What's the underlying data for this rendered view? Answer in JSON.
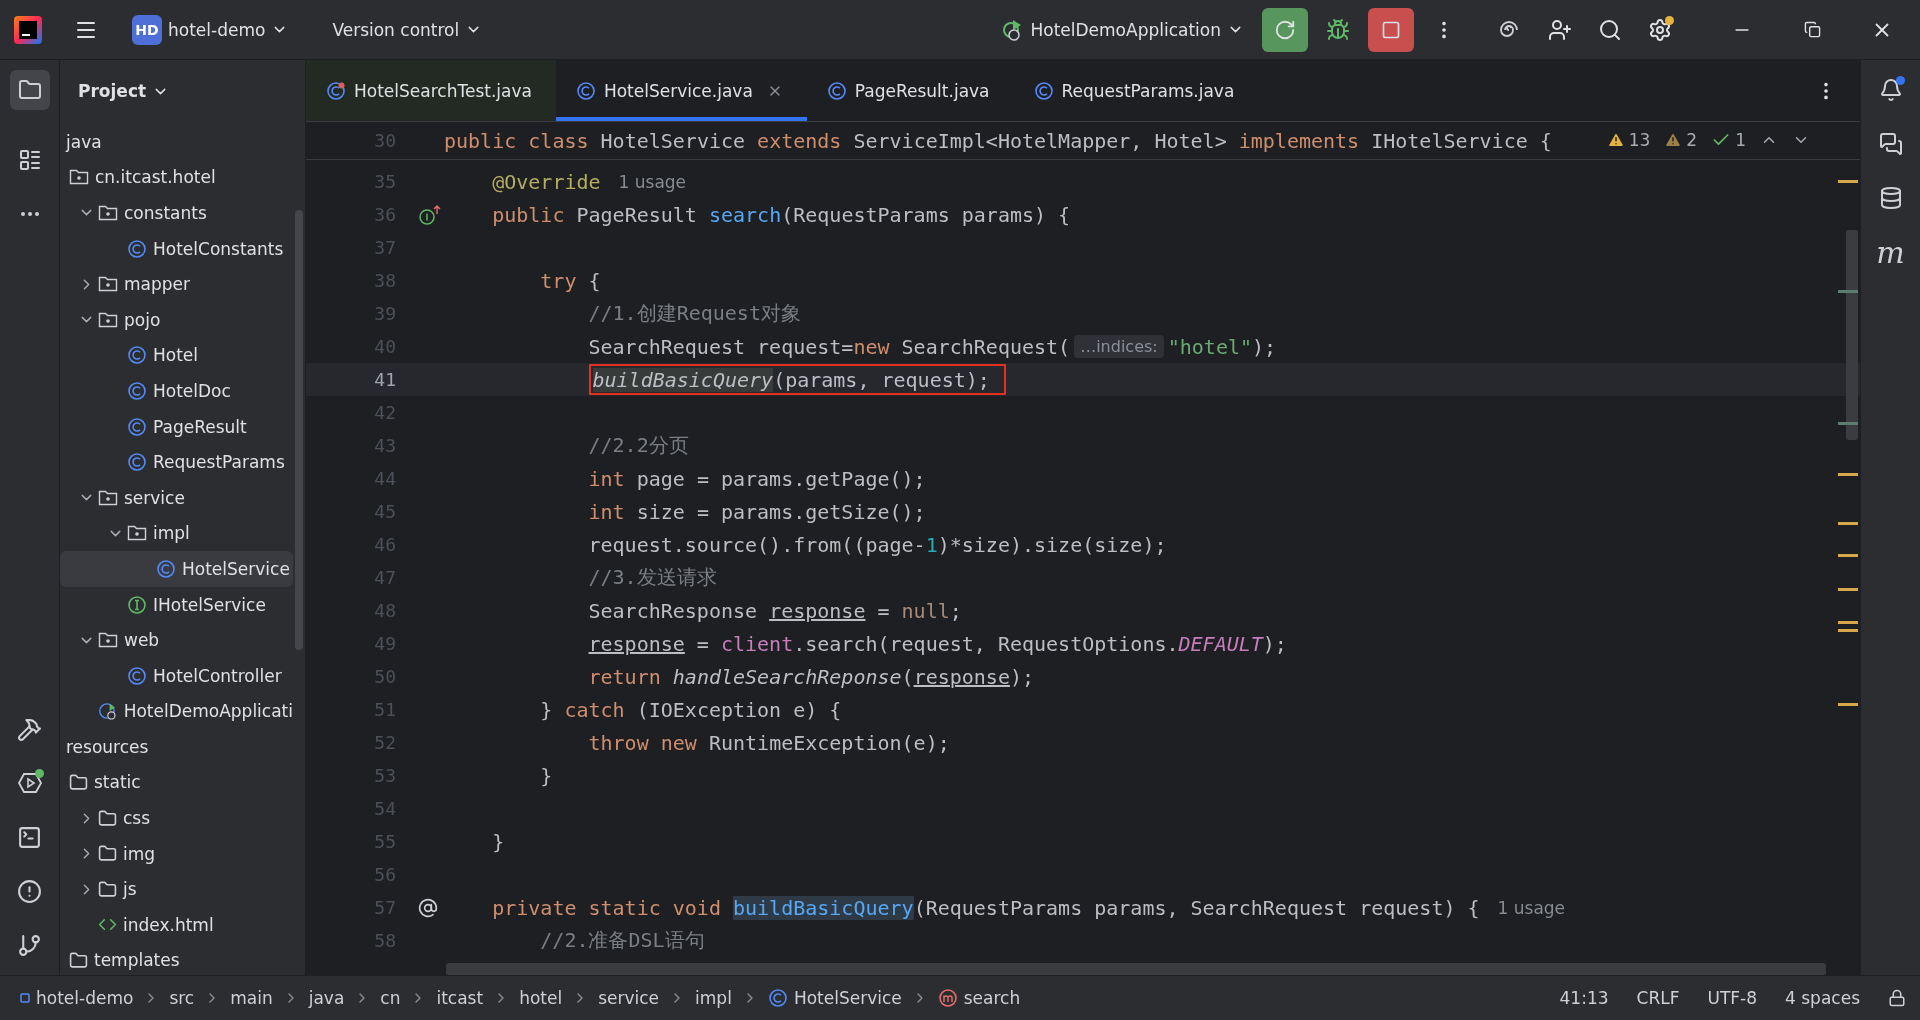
{
  "title_bar": {
    "project_badge": "HD",
    "project": "hotel-demo",
    "vcs": "Version control",
    "run_config": "HotelDemoApplication"
  },
  "project_panel": {
    "title": "Project",
    "tree": [
      {
        "label": "java",
        "kind": "root",
        "selected": false,
        "children": [
          {
            "label": "cn.itcast.hotel",
            "kind": "package",
            "selected": false,
            "children": [
              {
                "label": "constants",
                "kind": "package",
                "selected": false,
                "expanded": true,
                "children": [
                  {
                    "label": "HotelConstants",
                    "kind": "class",
                    "selected": false
                  }
                ]
              },
              {
                "label": "mapper",
                "kind": "package",
                "selected": false,
                "expanded": false
              },
              {
                "label": "pojo",
                "kind": "package",
                "selected": false,
                "expanded": true,
                "children": [
                  {
                    "label": "Hotel",
                    "kind": "class",
                    "selected": false
                  },
                  {
                    "label": "HotelDoc",
                    "kind": "class",
                    "selected": false
                  },
                  {
                    "label": "PageResult",
                    "kind": "class",
                    "selected": false
                  },
                  {
                    "label": "RequestParams",
                    "kind": "class",
                    "selected": false
                  }
                ]
              },
              {
                "label": "service",
                "kind": "package",
                "selected": false,
                "expanded": true,
                "children": [
                  {
                    "label": "impl",
                    "kind": "package",
                    "selected": false,
                    "expanded": true,
                    "children": [
                      {
                        "label": "HotelService",
                        "kind": "class",
                        "selected": true
                      }
                    ]
                  },
                  {
                    "label": "IHotelService",
                    "kind": "interface",
                    "selected": false
                  }
                ]
              },
              {
                "label": "web",
                "kind": "package",
                "selected": false,
                "expanded": true,
                "children": [
                  {
                    "label": "HotelController",
                    "kind": "class",
                    "selected": false
                  }
                ]
              },
              {
                "label": "HotelDemoApplicati",
                "kind": "app",
                "selected": false
              }
            ]
          }
        ]
      },
      {
        "label": "resources",
        "kind": "root",
        "selected": false,
        "children": [
          {
            "label": "static",
            "kind": "folder",
            "selected": false,
            "children": [
              {
                "label": "css",
                "kind": "folder",
                "selected": false,
                "expanded": false
              },
              {
                "label": "img",
                "kind": "folder",
                "selected": false,
                "expanded": false
              },
              {
                "label": "js",
                "kind": "folder",
                "selected": false,
                "expanded": false
              },
              {
                "label": "index.html",
                "kind": "html",
                "selected": false
              }
            ]
          },
          {
            "label": "templates",
            "kind": "folder",
            "selected": false
          }
        ]
      }
    ]
  },
  "tabs": [
    {
      "label": "HotelSearchTest.java",
      "kind": "test",
      "selected": false
    },
    {
      "label": "HotelService.java",
      "kind": "class",
      "selected": true
    },
    {
      "label": "PageResult.java",
      "kind": "class",
      "selected": false
    },
    {
      "label": "RequestParams.java",
      "kind": "class",
      "selected": false
    }
  ],
  "editor": {
    "problems": {
      "warnings": "13",
      "weak_warnings": "2",
      "typos": "1"
    },
    "sticky": {
      "n": "30",
      "tokens": [
        {
          "text": "public ",
          "kind": "kw"
        },
        {
          "text": "class ",
          "kind": "kw"
        },
        {
          "text": "HotelService ",
          "kind": "plain"
        },
        {
          "text": "extends ",
          "kind": "kw"
        },
        {
          "text": "ServiceImpl<HotelMapper, Hotel> ",
          "kind": "plain"
        },
        {
          "text": "implements ",
          "kind": "kw"
        },
        {
          "text": "IHotelService {",
          "kind": "plain"
        }
      ]
    },
    "lines": [
      {
        "n": "35",
        "current": false,
        "boxed": false,
        "tokens": [
          {
            "text": "    @Override",
            "kind": "annotation"
          },
          {
            "text": "1 usage",
            "kind": "hint"
          }
        ]
      },
      {
        "n": "36",
        "current": false,
        "boxed": false,
        "gutter": {
          "kind": "implements"
        },
        "tokens": [
          {
            "text": "    public ",
            "kind": "kw"
          },
          {
            "text": "PageResult ",
            "kind": "plain"
          },
          {
            "text": "search",
            "kind": "decl"
          },
          {
            "text": "(RequestParams params) {",
            "kind": "plain"
          }
        ]
      },
      {
        "n": "37",
        "current": false,
        "boxed": false
      },
      {
        "n": "38",
        "current": false,
        "boxed": false,
        "tokens": [
          {
            "text": "        try ",
            "kind": "kw"
          },
          {
            "text": "{",
            "kind": "plain"
          }
        ]
      },
      {
        "n": "39",
        "current": false,
        "boxed": false,
        "tokens": [
          {
            "text": "            //1.创建Request对象",
            "kind": "comment"
          }
        ]
      },
      {
        "n": "40",
        "current": false,
        "boxed": false,
        "tokens": [
          {
            "text": "            SearchRequest request=",
            "kind": "plain"
          },
          {
            "text": "new ",
            "kind": "kw"
          },
          {
            "text": "SearchRequest(",
            "kind": "plain"
          },
          {
            "text": "…indices:",
            "kind": "inlay"
          },
          {
            "text": "\"hotel\"",
            "kind": "string"
          },
          {
            "text": ");",
            "kind": "plain"
          }
        ]
      },
      {
        "n": "41",
        "current": true,
        "boxed": true,
        "tokens": [
          {
            "text": "            buildBasicQuery",
            "kind": "call_hl"
          },
          {
            "text": "(params, request);",
            "kind": "plain"
          }
        ]
      },
      {
        "n": "42",
        "current": false,
        "boxed": false
      },
      {
        "n": "43",
        "current": false,
        "boxed": false,
        "tokens": [
          {
            "text": "            //2.2分页",
            "kind": "comment"
          }
        ]
      },
      {
        "n": "44",
        "current": false,
        "boxed": false,
        "tokens": [
          {
            "text": "            int ",
            "kind": "kw"
          },
          {
            "text": "page = params.getPage();",
            "kind": "plain"
          }
        ]
      },
      {
        "n": "45",
        "current": false,
        "boxed": false,
        "tokens": [
          {
            "text": "            int ",
            "kind": "kw"
          },
          {
            "text": "size = params.getSize();",
            "kind": "plain"
          }
        ]
      },
      {
        "n": "46",
        "current": false,
        "boxed": false,
        "tokens": [
          {
            "text": "            request.source().from((page-",
            "kind": "plain"
          },
          {
            "text": "1",
            "kind": "number"
          },
          {
            "text": ")*size).size(size);",
            "kind": "plain"
          }
        ]
      },
      {
        "n": "47",
        "current": false,
        "boxed": false,
        "tokens": [
          {
            "text": "            //3.发送请求",
            "kind": "comment"
          }
        ]
      },
      {
        "n": "48",
        "current": false,
        "boxed": false,
        "tokens": [
          {
            "text": "            SearchResponse ",
            "kind": "plain"
          },
          {
            "text": "response",
            "kind": "var"
          },
          {
            "text": " = ",
            "kind": "plain"
          },
          {
            "text": "null",
            "kind": "null"
          },
          {
            "text": ";",
            "kind": "plain"
          }
        ]
      },
      {
        "n": "49",
        "current": false,
        "boxed": false,
        "tokens": [
          {
            "text": "            response",
            "kind": "var"
          },
          {
            "text": " = ",
            "kind": "plain"
          },
          {
            "text": "client",
            "kind": "field"
          },
          {
            "text": ".search(request, RequestOptions.",
            "kind": "plain"
          },
          {
            "text": "DEFAULT",
            "kind": "static_field"
          },
          {
            "text": ");",
            "kind": "plain"
          }
        ]
      },
      {
        "n": "50",
        "current": false,
        "boxed": false,
        "tokens": [
          {
            "text": "            return ",
            "kind": "kw"
          },
          {
            "text": "handleSearchReponse",
            "kind": "static_call"
          },
          {
            "text": "(",
            "kind": "plain"
          },
          {
            "text": "response",
            "kind": "var"
          },
          {
            "text": ");",
            "kind": "plain"
          }
        ]
      },
      {
        "n": "51",
        "current": false,
        "boxed": false,
        "tokens": [
          {
            "text": "        } ",
            "kind": "plain"
          },
          {
            "text": "catch ",
            "kind": "kw"
          },
          {
            "text": "(IOException e) {",
            "kind": "plain"
          }
        ]
      },
      {
        "n": "52",
        "current": false,
        "boxed": false,
        "tokens": [
          {
            "text": "            throw ",
            "kind": "kw"
          },
          {
            "text": "new ",
            "kind": "kw"
          },
          {
            "text": "RuntimeException(e);",
            "kind": "plain"
          }
        ]
      },
      {
        "n": "53",
        "current": false,
        "boxed": false,
        "tokens": [
          {
            "text": "        }",
            "kind": "plain"
          }
        ]
      },
      {
        "n": "54",
        "current": false,
        "boxed": false
      },
      {
        "n": "55",
        "current": false,
        "boxed": false,
        "tokens": [
          {
            "text": "    }",
            "kind": "plain"
          }
        ]
      },
      {
        "n": "56",
        "current": false,
        "boxed": false
      },
      {
        "n": "57",
        "current": false,
        "boxed": false,
        "gutter": {
          "kind": "annotation"
        },
        "tokens": [
          {
            "text": "    private static void ",
            "kind": "kw"
          },
          {
            "text": "buildBasicQuery",
            "kind": "decl_hl"
          },
          {
            "text": "(RequestParams params, SearchRequest request) {",
            "kind": "plain"
          },
          {
            "text": "1 usage",
            "kind": "hint"
          }
        ]
      },
      {
        "n": "58",
        "current": false,
        "boxed": false,
        "tokens": [
          {
            "text": "        //2.准备DSL语句",
            "kind": "comment"
          }
        ]
      }
    ]
  },
  "right_strip": {
    "maven": "m"
  },
  "status_bar": {
    "breadcrumbs": [
      {
        "label": "hotel-demo",
        "kind": "module"
      },
      {
        "label": "src",
        "kind": "dir"
      },
      {
        "label": "main",
        "kind": "dir"
      },
      {
        "label": "java",
        "kind": "dir"
      },
      {
        "label": "cn",
        "kind": "dir"
      },
      {
        "label": "itcast",
        "kind": "dir"
      },
      {
        "label": "hotel",
        "kind": "dir"
      },
      {
        "label": "service",
        "kind": "dir"
      },
      {
        "label": "impl",
        "kind": "dir"
      },
      {
        "label": "HotelService",
        "kind": "class"
      },
      {
        "label": "search",
        "kind": "method"
      }
    ],
    "position": "41:13",
    "line_separator": "CRLF",
    "encoding": "UTF-8",
    "indent": "4 spaces"
  }
}
